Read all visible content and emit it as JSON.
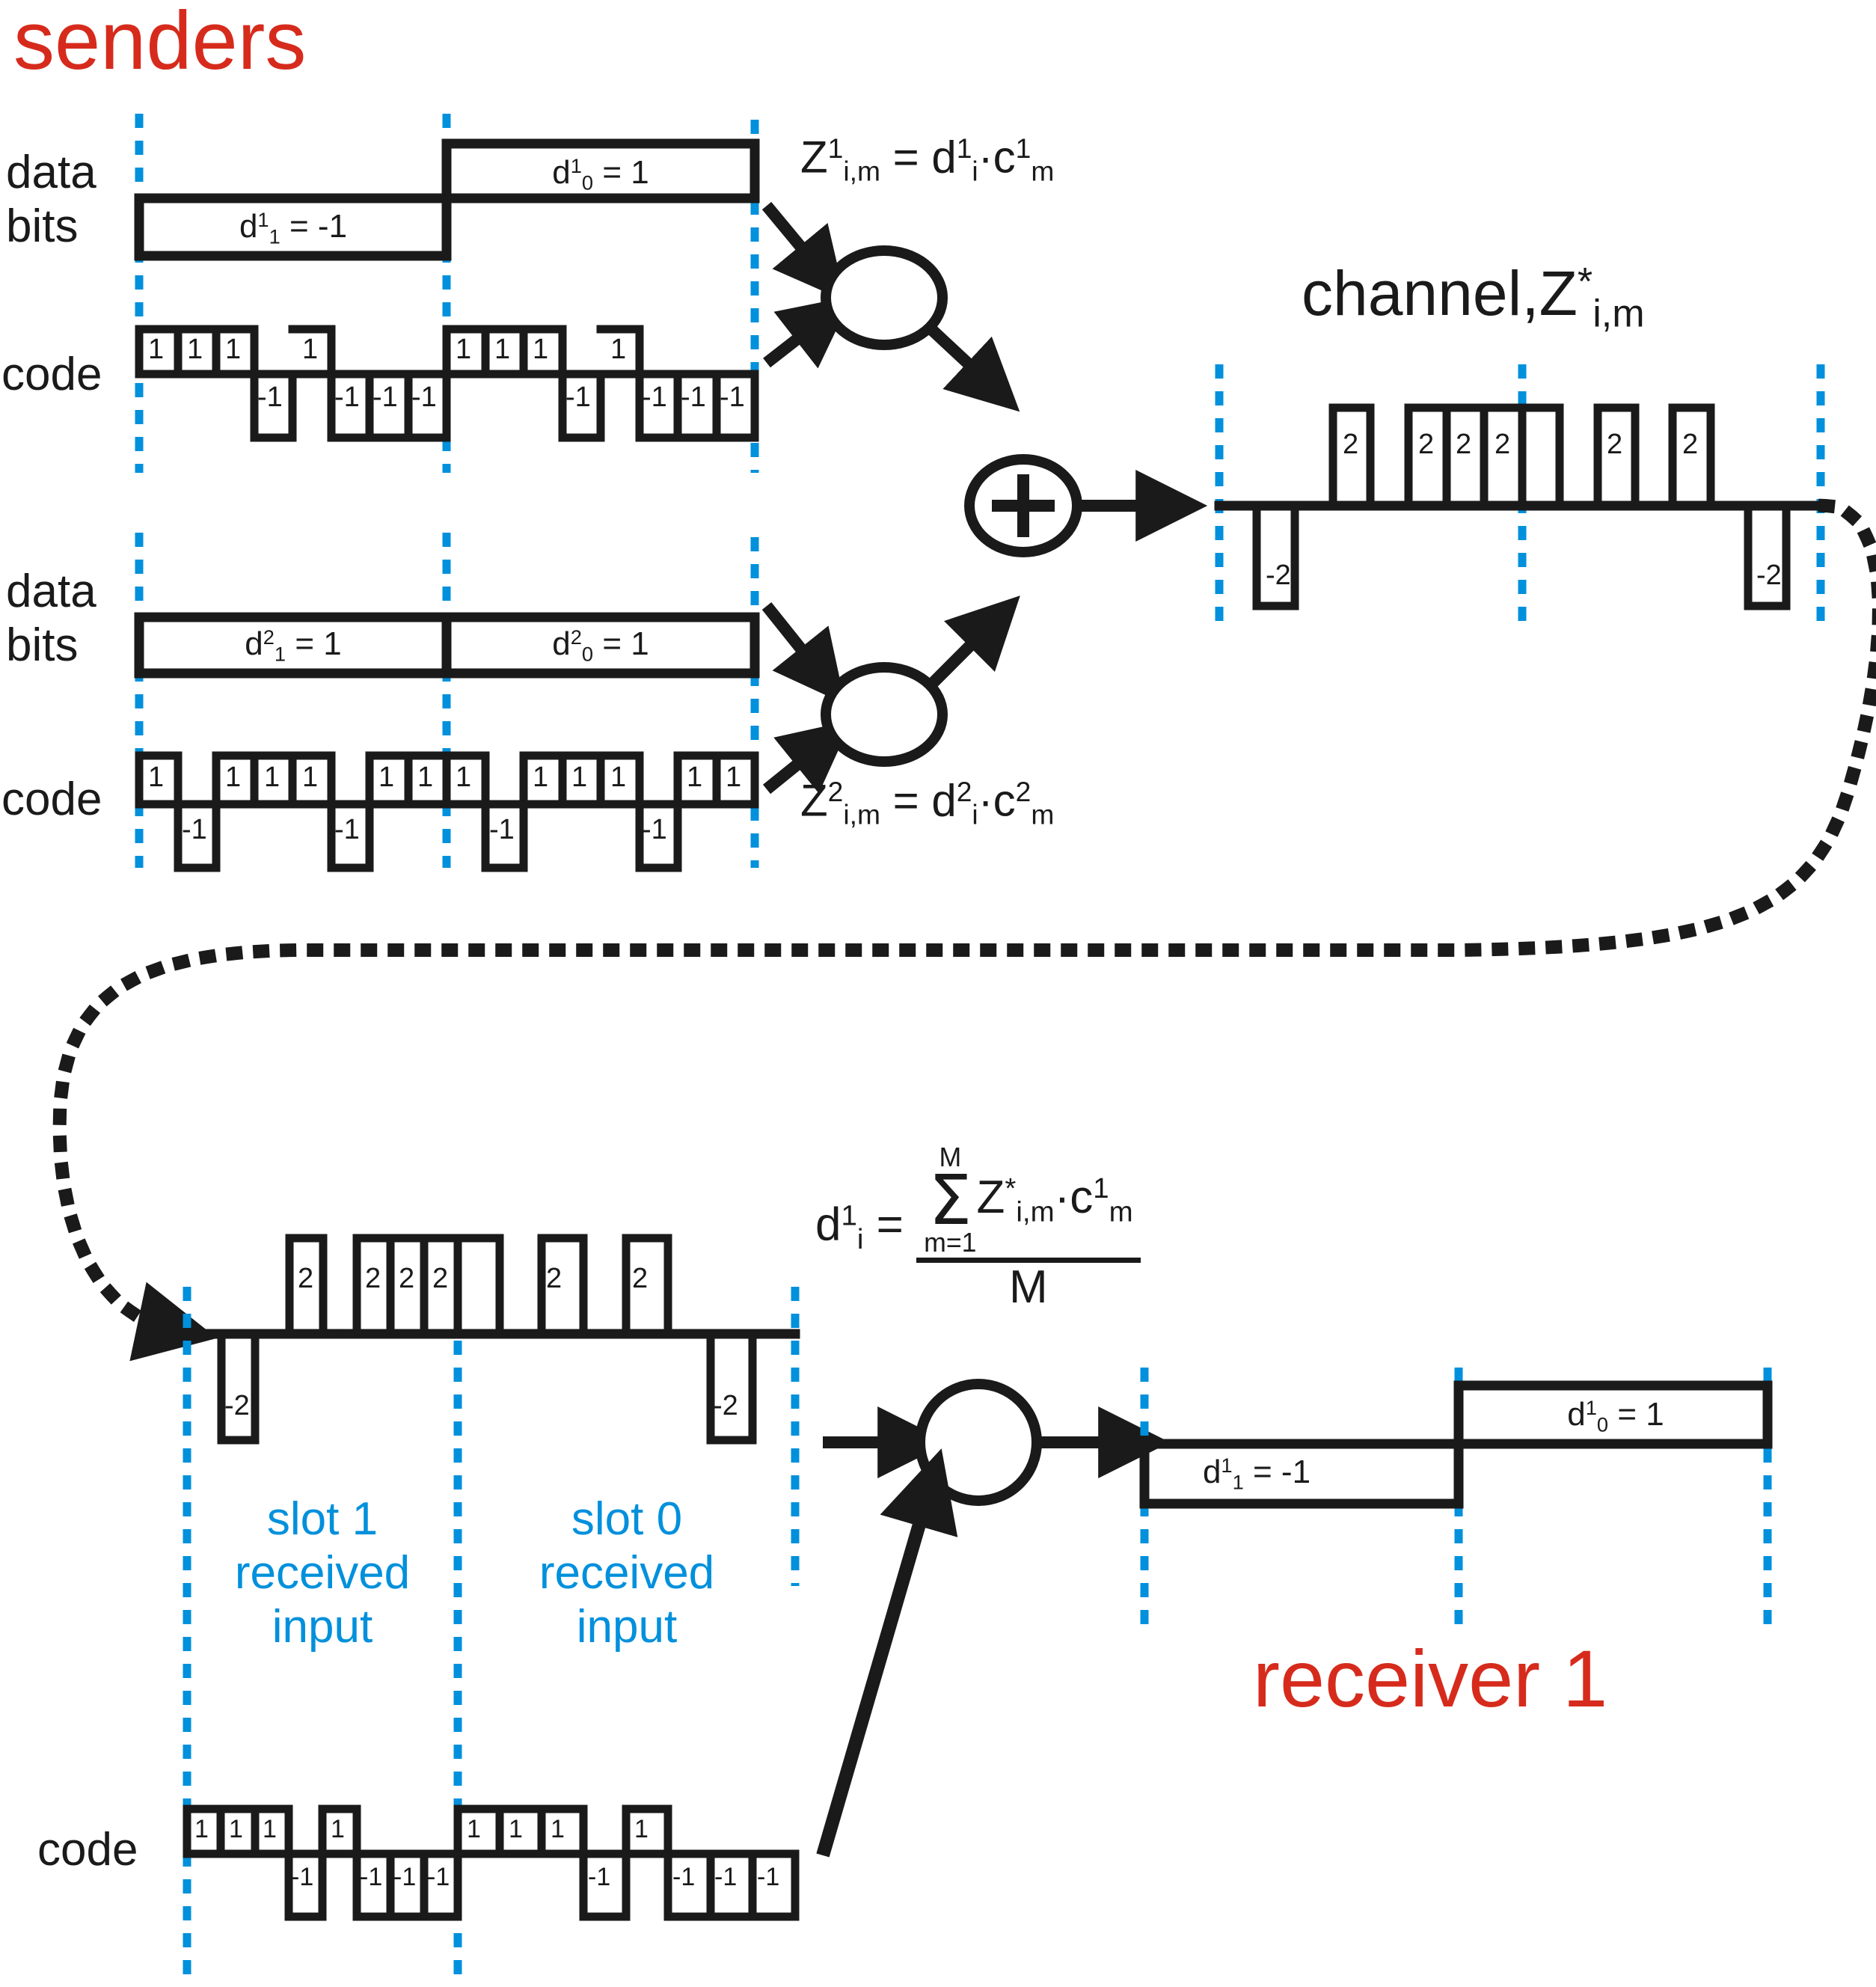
{
  "title": "CDMA sender/receiver encoding and decoding diagram",
  "labels": {
    "senders": "senders",
    "receiver": "receiver 1",
    "data_bits_1": "data",
    "data_bits_2": "bits",
    "code": "code",
    "channel": "channel,Z"
  },
  "colors": {
    "red": "#D62B1C",
    "blue": "#0090DC",
    "black": "#1a1a1a"
  },
  "sender1": {
    "row_label_top": "data",
    "row_label_bottom": "bits",
    "code_label": "code",
    "slot1_bit": "d",
    "slot1_sub": "1",
    "slot1_sup": "1",
    "slot1_value": "= -1",
    "slot0_bit": "d",
    "slot0_sub": "0",
    "slot0_sup": "1",
    "slot0_value": "= 1",
    "formula": {
      "z": "Z",
      "z_sub": "i,m",
      "z_sup": "1",
      "eq": "=",
      "d": "d",
      "d_sub": "i",
      "d_sup": "1",
      "dot": "·",
      "c": "c",
      "c_sub": "m",
      "c_sup": "1"
    }
  },
  "sender2": {
    "row_label_top": "data",
    "row_label_bottom": "bits",
    "code_label": "code",
    "slot1_bit": "d",
    "slot1_sub": "1",
    "slot1_sup": "2",
    "slot1_value": "= 1",
    "slot0_bit": "d",
    "slot0_sub": "0",
    "slot0_sup": "2",
    "slot0_value": "= 1",
    "formula": {
      "z": "Z",
      "z_sub": "i,m",
      "z_sup": "2",
      "eq": "=",
      "d": "d",
      "d_sub": "i",
      "d_sup": "2",
      "dot": "·",
      "c": "c",
      "c_sub": "m",
      "c_sup": "2"
    }
  },
  "adder": {
    "symbol": "+"
  },
  "channel": {
    "label_text": "channel,Z",
    "label_sup": "*",
    "label_sub": "i,m"
  },
  "receiver": {
    "title": "receiver 1",
    "code_label": "code",
    "slot1_caption": [
      "slot 1",
      "received",
      "input"
    ],
    "slot0_caption": [
      "slot 0",
      "received",
      "input"
    ],
    "out_slot1_bit": "d",
    "out_slot1_sub": "1",
    "out_slot1_sup": "1",
    "out_slot1_value": "= -1",
    "out_slot0_bit": "d",
    "out_slot0_sub": "0",
    "out_slot0_sup": "1",
    "out_slot0_value": "= 1",
    "formula": {
      "d": "d",
      "d_sub": "i",
      "d_sup": "1",
      "eq": "=",
      "sum_top": "M",
      "sum_sym": "Σ",
      "sum_bot": "m=1",
      "z": "Z",
      "z_sub": "i,m",
      "z_sup": "*",
      "dot": "·",
      "c": "c",
      "c_sub": "m",
      "c_sup": "1",
      "denominator": "M"
    }
  },
  "chart_data": {
    "type": "line",
    "title": "CDMA chip-level waveforms",
    "chips_per_slot": 8,
    "series": [
      {
        "name": "sender1_code",
        "label": "code (sender 1)",
        "slot1": [
          1,
          1,
          1,
          -1,
          1,
          -1,
          -1,
          -1
        ],
        "slot0": [
          1,
          1,
          1,
          -1,
          1,
          -1,
          -1,
          -1
        ],
        "value_labels": [
          "1",
          "-1"
        ]
      },
      {
        "name": "sender2_code",
        "label": "code (sender 2)",
        "slot1": [
          1,
          -1,
          1,
          1,
          1,
          -1,
          1,
          1
        ],
        "slot0": [
          1,
          -1,
          1,
          1,
          1,
          -1,
          1,
          1
        ],
        "value_labels": [
          "1",
          "-1"
        ]
      },
      {
        "name": "channel_sum",
        "label": "channel Z*",
        "slot1": [
          0,
          -2,
          2,
          0,
          2,
          2,
          0,
          0
        ],
        "slot0": [
          2,
          0,
          2,
          0,
          2,
          0,
          -2,
          0
        ],
        "value_labels": [
          "2",
          "-2"
        ]
      },
      {
        "name": "receiver_input",
        "label": "slot received input",
        "slot1": [
          0,
          -2,
          2,
          0,
          2,
          2,
          0,
          0
        ],
        "slot0": [
          2,
          0,
          2,
          0,
          2,
          0,
          -2,
          0
        ],
        "value_labels": [
          "2",
          "-2"
        ]
      },
      {
        "name": "receiver_code",
        "label": "code (receiver 1)",
        "slot1": [
          1,
          1,
          1,
          -1,
          1,
          -1,
          -1,
          -1
        ],
        "slot0": [
          1,
          1,
          1,
          -1,
          1,
          -1,
          -1,
          -1
        ],
        "value_labels": [
          "1",
          "-1"
        ]
      }
    ],
    "data_bits": {
      "sender1": {
        "slot1": -1,
        "slot0": 1
      },
      "sender2": {
        "slot1": 1,
        "slot0": 1
      },
      "receiver1_out": {
        "slot1": -1,
        "slot0": 1
      }
    }
  }
}
